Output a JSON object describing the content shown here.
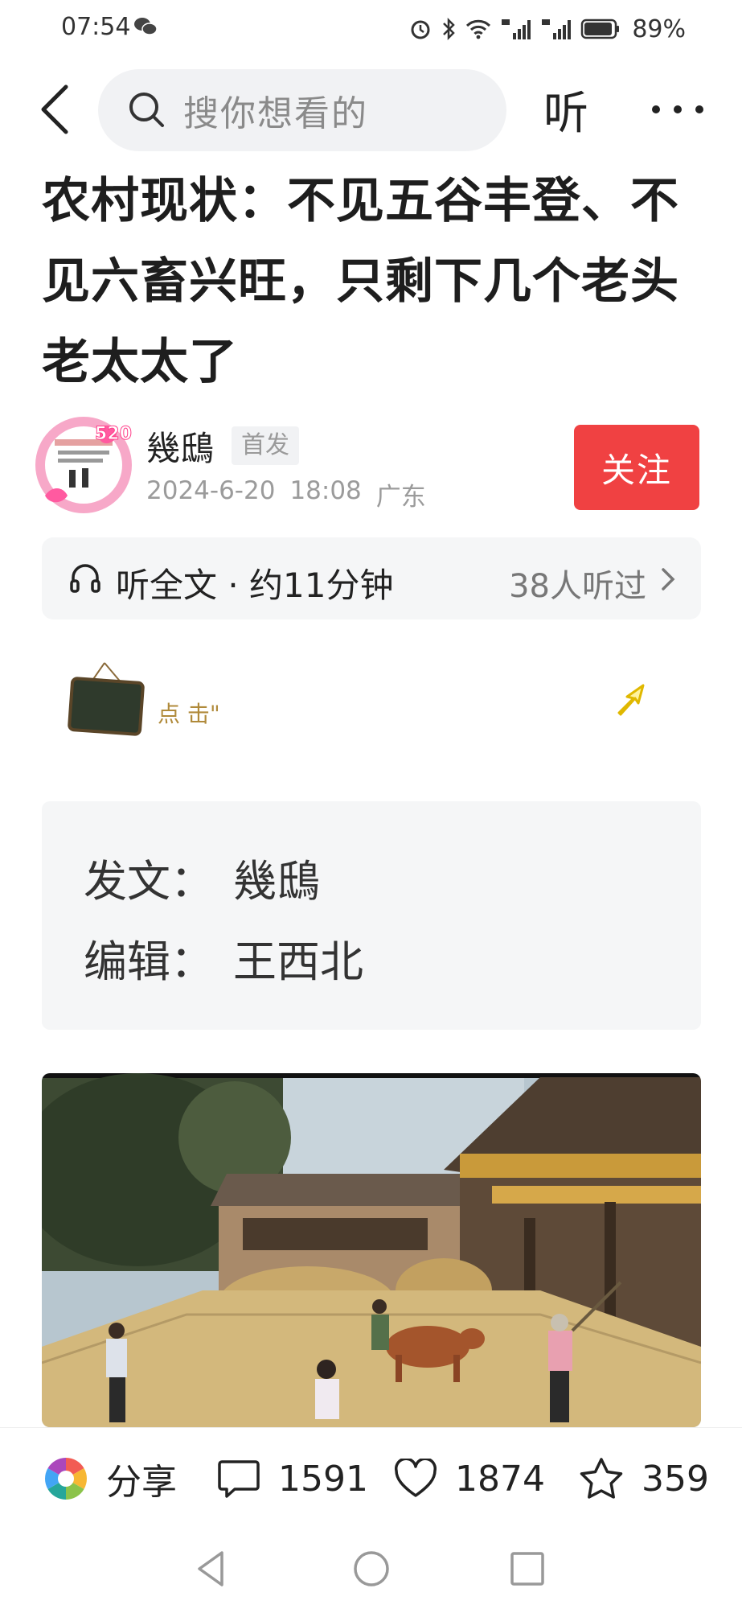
{
  "status_bar": {
    "time": "07:54",
    "battery": "89%"
  },
  "nav": {
    "search_placeholder": "搜你想看的",
    "listen_label": "听"
  },
  "article": {
    "title": "农村现状：不见五谷丰登、不见六畜兴旺，只剩下几个老头老太太了"
  },
  "author": {
    "name": "幾鴟",
    "badge": "首发",
    "date": "2024-6-20",
    "time": "18:08",
    "location": "广东",
    "follow_label": "关注",
    "avatar_badge": "520"
  },
  "listen_bar": {
    "label": "听全文 · 约11分钟",
    "count": "38人听过"
  },
  "banner": {
    "click_text": "点 击\""
  },
  "credits": {
    "author_label": "发文：",
    "author_value": "幾鴟",
    "editor_label": "编辑：",
    "editor_value": "王西北"
  },
  "actions": {
    "share_label": "分享",
    "comments": "1591",
    "likes": "1874",
    "favorites": "359"
  },
  "colors": {
    "follow": "#f04142",
    "panel": "#f5f6f7",
    "search_bg": "#f1f2f4"
  }
}
